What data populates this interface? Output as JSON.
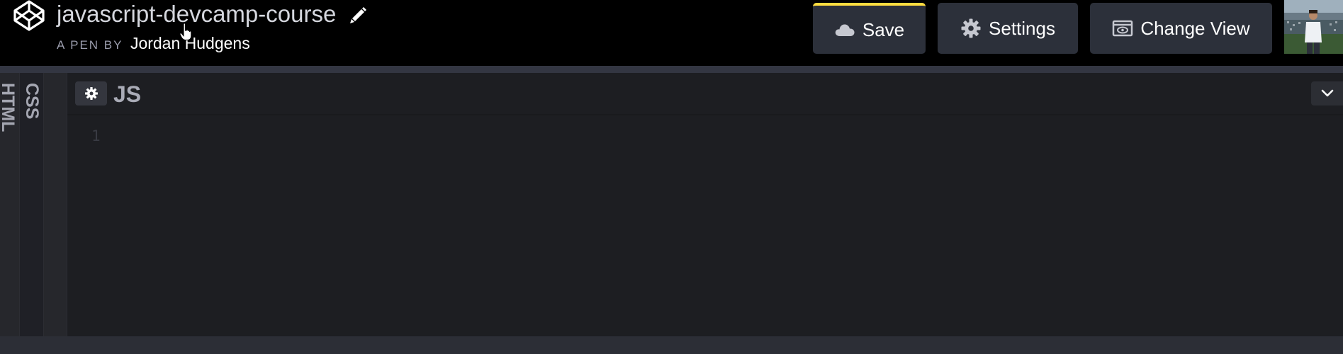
{
  "header": {
    "pen_title": "javascript-devcamp-course",
    "byline_prefix": "A PEN BY",
    "author": "Jordan Hudgens",
    "save_label": "Save",
    "settings_label": "Settings",
    "change_view_label": "Change View",
    "save_accent_color": "#ffdd40",
    "icons": {
      "logo": "codepen-logo-icon",
      "edit": "pencil-icon",
      "save": "cloud-icon",
      "settings": "gear-icon",
      "change_view": "eye-window-icon"
    }
  },
  "editors": {
    "collapsed": [
      "HTML",
      "CSS"
    ],
    "active": {
      "title": "JS",
      "line_numbers": [
        "1"
      ],
      "settings_icon": "gear-icon",
      "collapse_icon": "chevron-down-icon"
    }
  }
}
